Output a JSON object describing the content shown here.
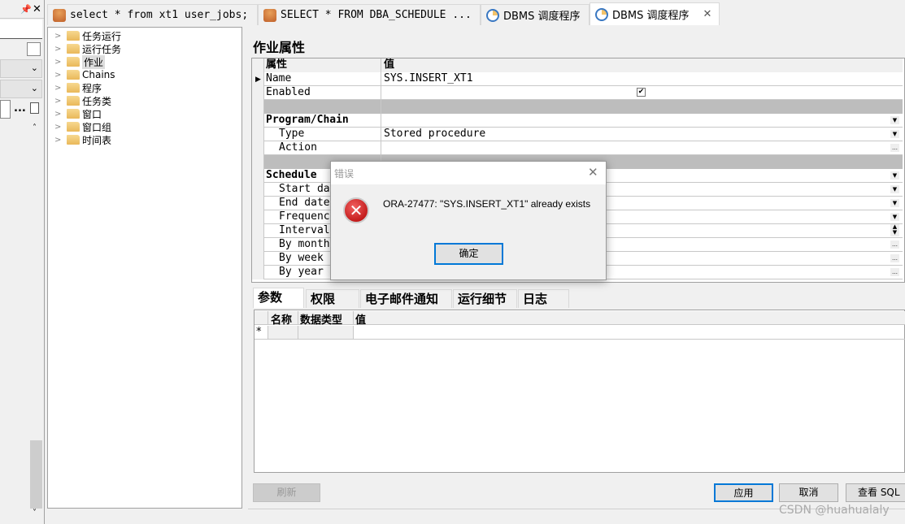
{
  "left_panel": {
    "more_label": "..."
  },
  "tabs": [
    {
      "label": "select * from xt1 user_jobs;",
      "icon": "database-icon"
    },
    {
      "label": "SELECT * FROM DBA_SCHEDULE ...",
      "icon": "database-icon"
    },
    {
      "label": "DBMS 调度程序",
      "icon": "clock-icon"
    },
    {
      "label": "DBMS 调度程序",
      "icon": "clock-icon",
      "active": true
    }
  ],
  "tree": {
    "items": [
      "任务运行",
      "运行任务",
      "作业",
      "Chains",
      "程序",
      "任务类",
      "窗口",
      "窗口组",
      "时间表"
    ],
    "selected": "作业"
  },
  "main": {
    "title": "作业属性",
    "grid": {
      "headers": [
        "属性",
        "值"
      ],
      "rows": [
        {
          "prop": "Name",
          "value": "SYS.INSERT_XT1"
        },
        {
          "prop": "Enabled",
          "value": "",
          "checked": true
        },
        {
          "prop": "",
          "value": ""
        },
        {
          "prop": "Program/Chain",
          "value": ""
        },
        {
          "prop": "Type",
          "value": "Stored procedure"
        },
        {
          "prop": "Action",
          "value": ""
        },
        {
          "prop": "",
          "value": ""
        },
        {
          "prop": "Schedule",
          "value": ""
        },
        {
          "prop": "Start date",
          "value": ""
        },
        {
          "prop": "End date",
          "value": ""
        },
        {
          "prop": "Frequency",
          "value": ""
        },
        {
          "prop": "Interval",
          "value": ""
        },
        {
          "prop": "By month",
          "value": ""
        },
        {
          "prop": "By week",
          "value": ""
        },
        {
          "prop": "By year",
          "value": ""
        }
      ]
    },
    "bottom_tabs": [
      "参数",
      "权限",
      "电子邮件通知",
      "运行细节",
      "日志"
    ],
    "param_grid": {
      "headers": [
        "名称",
        "数据类型",
        "值"
      ],
      "new_row_marker": "*"
    },
    "buttons": {
      "refresh": "刷新",
      "apply": "应用",
      "cancel": "取消",
      "view_sql": "查看 SQL"
    }
  },
  "dialog": {
    "title": "错误",
    "message": "ORA-27477: \"SYS.INSERT_XT1\" already exists",
    "ok": "确定",
    "icon": "error-icon"
  },
  "watermark": "CSDN @huahualaly"
}
